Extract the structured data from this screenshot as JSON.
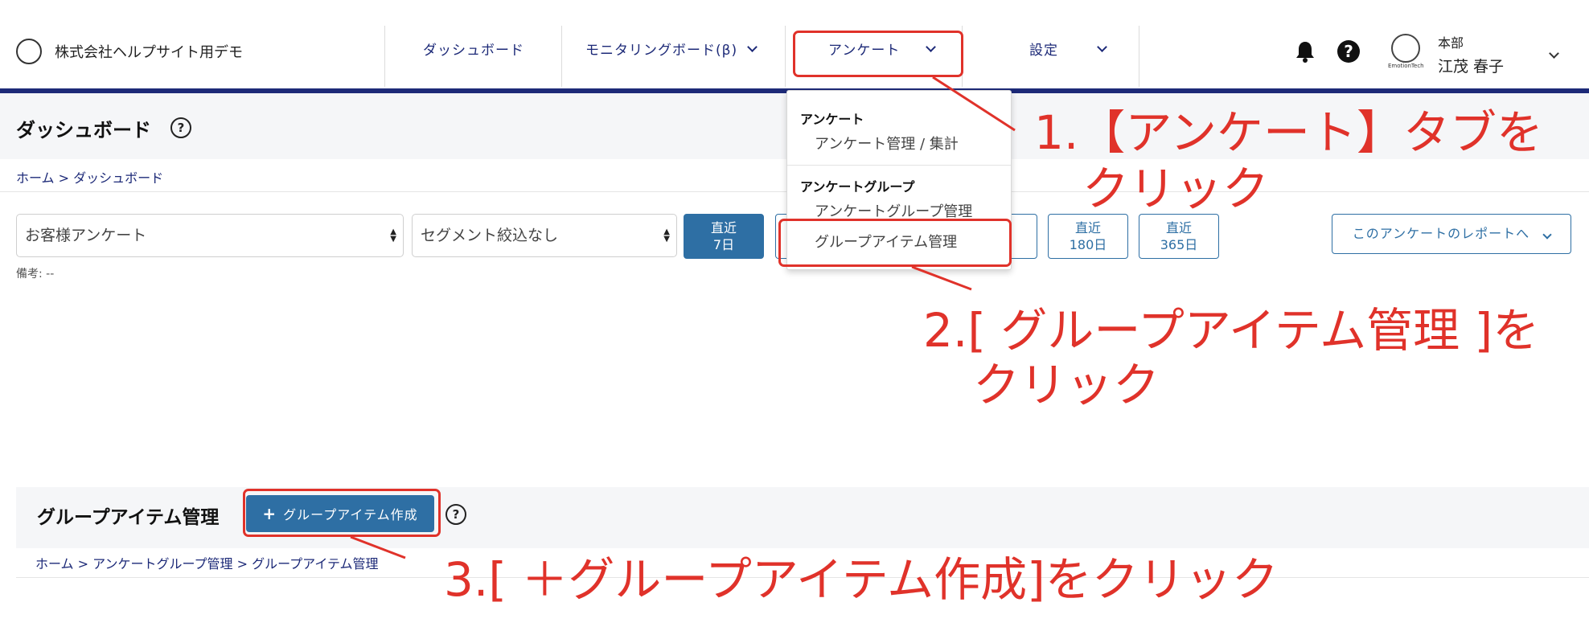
{
  "header": {
    "company": "株式会社ヘルプサイト用デモ",
    "nav": [
      {
        "label": "ダッシュボード"
      },
      {
        "label": "モニタリングボード(β)"
      },
      {
        "label": "アンケート"
      },
      {
        "label": "設定"
      }
    ],
    "user": {
      "org": "本部",
      "name": "江茂 春子",
      "avatar_caption": "EmotionTech"
    }
  },
  "page": {
    "title": "ダッシュボード",
    "breadcrumb": "ホーム > ダッシュボード",
    "survey_select": "お客様アンケート",
    "segment_select": "セグメント絞込なし",
    "ranges": [
      {
        "line1": "直近",
        "line2": "7日"
      },
      {
        "line1": "直近",
        "line2": "180日"
      },
      {
        "line1": "直近",
        "line2": "365日"
      }
    ],
    "report_button": "このアンケートのレポートへ",
    "note": "備考: --"
  },
  "dropdown": {
    "section1_title": "アンケート",
    "section1_item": "アンケート管理 / 集計",
    "section2_title": "アンケートグループ",
    "section2_item1": "アンケートグループ管理",
    "section2_item2": "グループアイテム管理"
  },
  "group_panel": {
    "title": "グループアイテム管理",
    "create_button": "グループアイテム作成",
    "breadcrumb": "ホーム > アンケートグループ管理 > グループアイテム管理"
  },
  "annotations": {
    "step1_line1": "1.【アンケート】タブを",
    "step1_line2": "クリック",
    "step2_line1": "2.[ グループアイテム管理 ]を",
    "step2_line2": "クリック",
    "step3": "3.[ ＋グループアイテム作成]をクリック"
  },
  "colors": {
    "accent": "#2e6fa4",
    "nav_bar": "#1d2a78",
    "annotation": "#e0322a"
  }
}
